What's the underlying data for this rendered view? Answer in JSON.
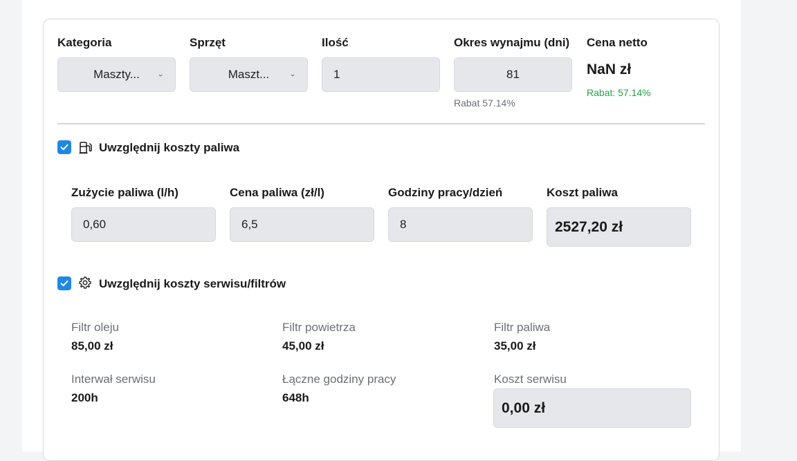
{
  "rental": {
    "category": {
      "label": "Kategoria",
      "value": "Maszty..."
    },
    "equipment": {
      "label": "Sprzęt",
      "value": "Maszt..."
    },
    "quantity": {
      "label": "Ilość",
      "value": "1"
    },
    "period": {
      "label": "Okres wynajmu (dni)",
      "value": "81",
      "discount": "Rabat 57.14%"
    },
    "net_price": {
      "label": "Cena netto",
      "value": "NaN zł",
      "discount": "Rabat: 57.14%"
    }
  },
  "fuel": {
    "checked": true,
    "icon": "fuel-pump-icon",
    "title": "Uwzględnij koszty paliwa",
    "consumption": {
      "label": "Zużycie paliwa (l/h)",
      "value": "0,60"
    },
    "price": {
      "label": "Cena paliwa (zł/l)",
      "value": "6,5"
    },
    "hours": {
      "label": "Godziny pracy/dzień",
      "value": "8"
    },
    "cost": {
      "label": "Koszt paliwa",
      "value": "2527,20 zł"
    }
  },
  "service": {
    "checked": true,
    "icon": "gear-icon",
    "title": "Uwzględnij koszty serwisu/filtrów",
    "oil_filter": {
      "label": "Filtr oleju",
      "value": "85,00 zł"
    },
    "air_filter": {
      "label": "Filtr powietrza",
      "value": "45,00 zł"
    },
    "fuel_filter": {
      "label": "Filtr paliwa",
      "value": "35,00 zł"
    },
    "interval": {
      "label": "Interwał serwisu",
      "value": "200h"
    },
    "total_hours": {
      "label": "Łączne godziny pracy",
      "value": "648h"
    },
    "cost": {
      "label": "Koszt serwisu",
      "value": "0,00 zł"
    }
  },
  "colors": {
    "accent": "#1e88e5",
    "success": "#24a148",
    "field_bg": "#e6e7eb"
  }
}
